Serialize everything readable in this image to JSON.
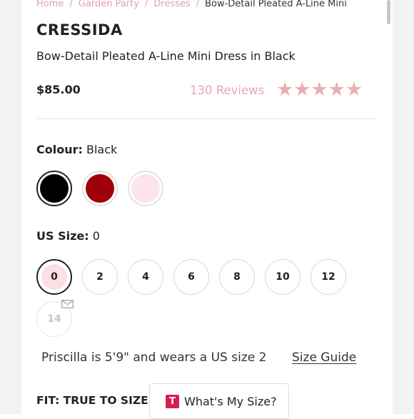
{
  "breadcrumb": {
    "items": [
      "Home",
      "Garden Party",
      "Dresses"
    ],
    "separator": "/",
    "current": "Bow-Detail Pleated A-Line Mini"
  },
  "product": {
    "brand": "CRESSIDA",
    "name": "Bow-Detail Pleated A-Line Mini Dress in Black",
    "price": "$85.00",
    "reviews_label": "130 Reviews",
    "rating_stars": 5,
    "star_glyphs": "★★★★★"
  },
  "colour": {
    "label": "Colour:",
    "selected": "Black",
    "swatches": [
      {
        "name": "black",
        "hex": "#000000",
        "selected": true
      },
      {
        "name": "red",
        "hex": "#a00008",
        "selected": false
      },
      {
        "name": "pink",
        "hex": "#fde4ea",
        "selected": false
      }
    ]
  },
  "size": {
    "label": "US Size:",
    "selected": "0",
    "options": [
      {
        "label": "0",
        "selected": true,
        "available": true
      },
      {
        "label": "2",
        "selected": false,
        "available": true
      },
      {
        "label": "4",
        "selected": false,
        "available": true
      },
      {
        "label": "6",
        "selected": false,
        "available": true
      },
      {
        "label": "8",
        "selected": false,
        "available": true
      },
      {
        "label": "10",
        "selected": false,
        "available": true
      },
      {
        "label": "12",
        "selected": false,
        "available": true
      },
      {
        "label": "14",
        "selected": false,
        "available": false,
        "icon": "envelope-icon"
      }
    ]
  },
  "model_info": "Priscilla is 5'9\" and wears a US size 2",
  "size_guide_label": "Size Guide",
  "fit": {
    "label": "FIT: TRUE TO SIZE",
    "button_label": "What's My Size?",
    "button_logo": "T"
  },
  "colors": {
    "accent_pink": "#e2a0a6",
    "star_pink": "#eaaeb2",
    "selected_size_fill": "#fbdfe2",
    "logo_red": "#d61f4e"
  }
}
